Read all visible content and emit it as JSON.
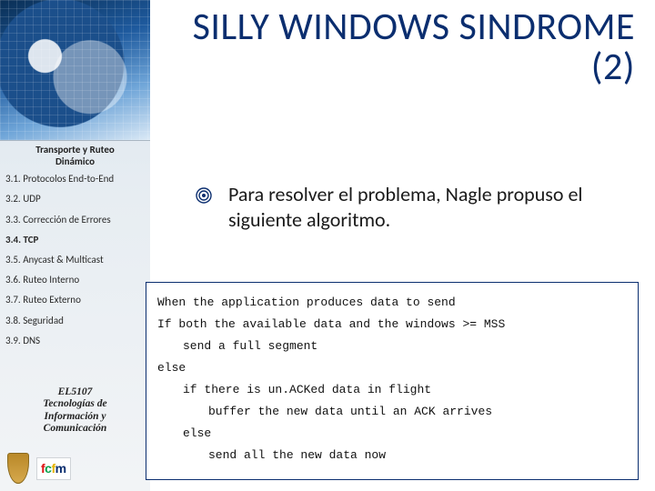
{
  "title_line1": "SILLY WINDOWS SINDROME",
  "title_line2": "(2)",
  "sidebar": {
    "header_l1": "Transporte y Ruteo",
    "header_l2": "Dinámico",
    "items": [
      "3.1. Protocolos End-to-End",
      "3.2. UDP",
      "3.3. Corrección de Errores",
      "3.4. TCP",
      "3.5. Anycast & Multicast",
      "3.6. Ruteo Interno",
      "3.7. Ruteo Externo",
      "3.8. Seguridad",
      "3.9. DNS"
    ],
    "bold_index": 3,
    "course_l1": "EL5107",
    "course_l2": "Tecnologías de",
    "course_l3": "Información y",
    "course_l4": "Comunicación",
    "logo_text": "fcfm"
  },
  "bullet": "Para resolver el problema, Nagle propuso el siguiente algoritmo.",
  "code": {
    "l0": "When the application produces data to send",
    "l1": "If both the available data and the windows >= MSS",
    "l2": "send a full segment",
    "l3": "else",
    "l4": "if there is un.ACKed data in flight",
    "l5": "buffer the new data until an ACK arrives",
    "l6": "else",
    "l7": "send all the new data now"
  }
}
